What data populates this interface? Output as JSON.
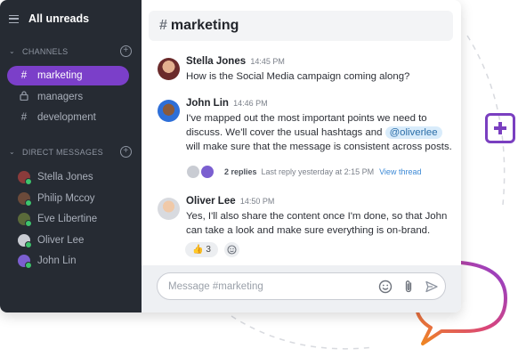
{
  "sidebar": {
    "all_unreads": "All unreads",
    "channels_header": "CHANNELS",
    "channels": [
      {
        "label": "marketing",
        "icon": "hash-icon",
        "active": true
      },
      {
        "label": "managers",
        "icon": "lock-icon",
        "active": false
      },
      {
        "label": "development",
        "icon": "hash-icon",
        "active": false
      }
    ],
    "dm_header": "DIRECT MESSAGES",
    "dms": [
      {
        "label": "Stella Jones"
      },
      {
        "label": "Philip Mccoy"
      },
      {
        "label": "Eve Libertine"
      },
      {
        "label": "Oliver Lee"
      },
      {
        "label": "John Lin"
      }
    ]
  },
  "channel": {
    "hash": "#",
    "name": "marketing"
  },
  "messages": [
    {
      "name": "Stella Jones",
      "time": "14:45 PM",
      "text": "How is the Social Media campaign coming along?"
    },
    {
      "name": "John Lin",
      "time": "14:46 PM",
      "text_before": "I've mapped out the most important points we need to discuss. We'll cover the usual hashtags and",
      "mention": "@oliverlee",
      "text_after": "will make sure that the message is consistent across posts."
    },
    {
      "name": "Oliver Lee",
      "time": "14:50 PM",
      "text": "Yes, I'll also share the content once I'm done, so that John can take a look and make sure everything is on-brand."
    }
  ],
  "thread": {
    "replies": "2 replies",
    "last_reply": "Last reply yesterday at 2:15 PM",
    "view": "View thread"
  },
  "reaction": {
    "emoji": "👍",
    "count": "3"
  },
  "composer": {
    "placeholder": "Message #marketing"
  },
  "colors": {
    "accent": "#7b3fc9",
    "sidebar_bg": "#262b33",
    "online": "#3ec46d",
    "link": "#3d8ad6"
  }
}
